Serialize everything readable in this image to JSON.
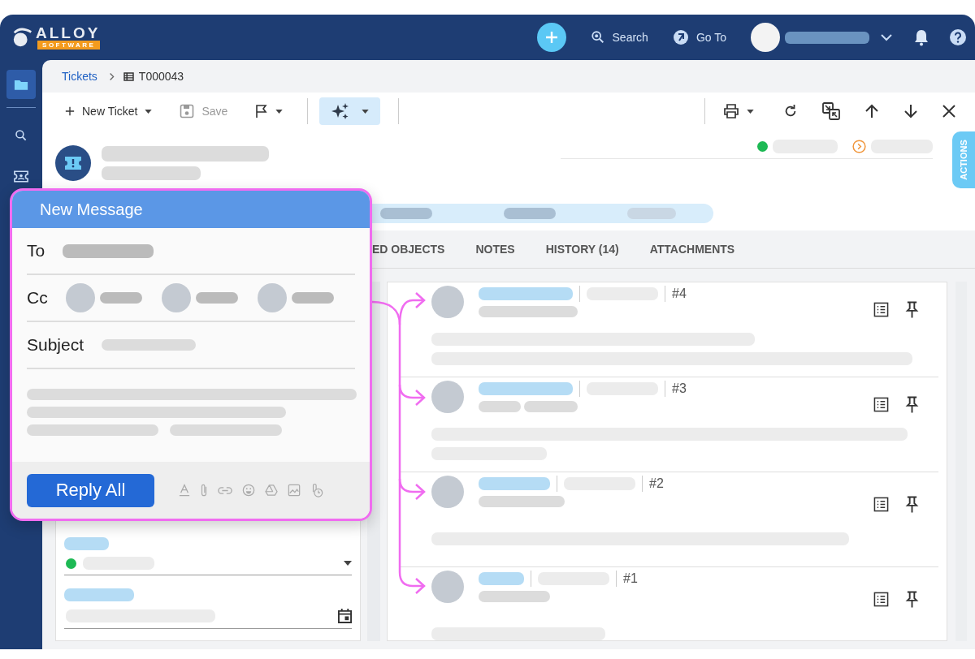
{
  "brand": {
    "name": "ALLOY",
    "sub": "SOFTWARE"
  },
  "topbar": {
    "search": "Search",
    "goto": "Go To"
  },
  "sidebar": {
    "items": [
      {
        "selected": true
      },
      {
        "selected": false
      },
      {
        "selected": false
      }
    ]
  },
  "breadcrumb": {
    "parent": "Tickets",
    "current": "T000043"
  },
  "toolbar": {
    "new_label": "New Ticket",
    "save_label": "Save",
    "save_disabled": true
  },
  "actions_tab": "ACTIONS",
  "tabs": [
    {
      "label": "ED OBJECTS"
    },
    {
      "label": "NOTES"
    },
    {
      "label": "HISTORY (14)"
    },
    {
      "label": "ATTACHMENTS"
    }
  ],
  "compose": {
    "title": "New Message",
    "to_label": "To",
    "cc_label": "Cc",
    "subject_label": "Subject",
    "send_label": "Reply All"
  },
  "history": [
    {
      "number": "#4"
    },
    {
      "number": "#3"
    },
    {
      "number": "#2"
    },
    {
      "number": "#1"
    }
  ]
}
